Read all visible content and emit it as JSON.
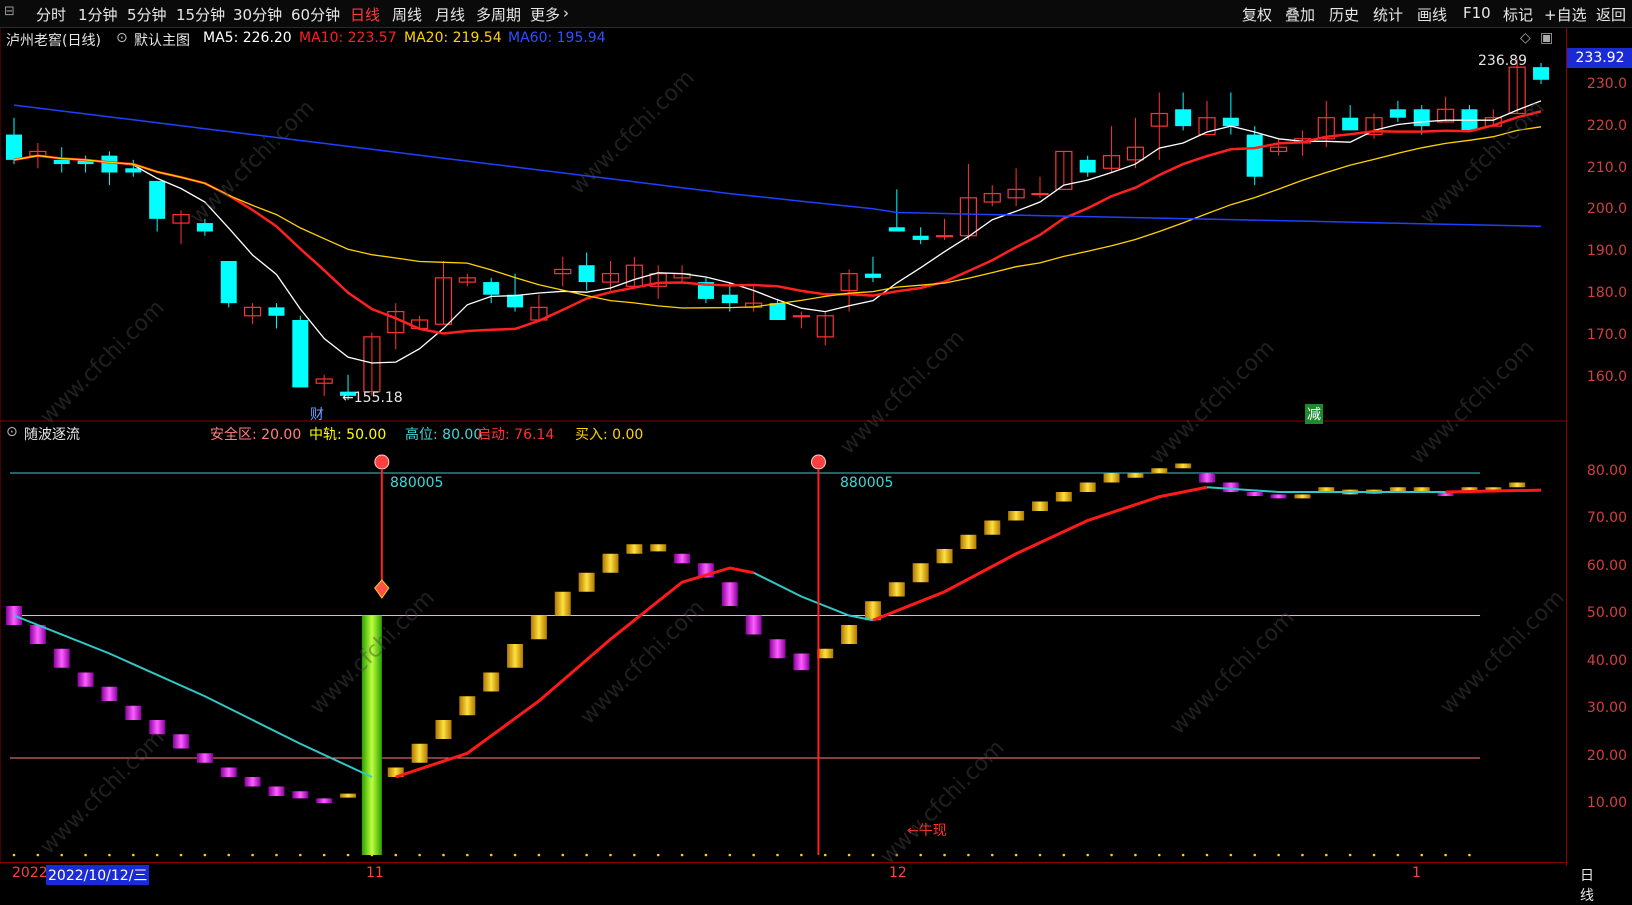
{
  "toolbar": {
    "menu_icon": "menu-icon",
    "left_items": [
      "分时",
      "1分钟",
      "5分钟",
      "15分钟",
      "30分钟",
      "60分钟",
      "日线",
      "周线",
      "月线",
      "多周期",
      "更多"
    ],
    "active_item": "日线",
    "more_arrow": "›",
    "right_items": [
      "复权",
      "叠加",
      "历史",
      "统计",
      "画线",
      "F10",
      "标记",
      "+自选",
      "返回"
    ]
  },
  "info": {
    "stock": "泸州老窖(日线)",
    "main_chart": "默认主图",
    "ma5": "MA5: 226.20",
    "ma10": "MA10: 223.57",
    "ma20": "MA20: 219.54",
    "ma60": "MA60: 195.94"
  },
  "colors": {
    "ma5": "#ffffff",
    "ma10": "#ff2020",
    "ma20": "#ffd200",
    "ma60": "#1e40ff",
    "up": "#ff3333",
    "down": "#00ffff",
    "axis": "#cc3333"
  },
  "main_axis": [
    "230.0",
    "220.0",
    "210.0",
    "200.0",
    "190.0",
    "180.0",
    "170.0",
    "160.0"
  ],
  "price_tag": "233.92",
  "high_label": "236.89",
  "low_label": "←155.18",
  "markers": {
    "cai": "财",
    "jian": "减"
  },
  "sub": {
    "name": "随波逐流",
    "safe": "安全区: 20.00",
    "mid": "中轨: 50.00",
    "high": "高位: 80.00",
    "start": "启动: 76.14",
    "buy": "买入: 0.00",
    "signal1": "880005",
    "signal2": "880005",
    "bull": "←牛现"
  },
  "sub_axis": [
    "80.00",
    "70.00",
    "60.00",
    "50.00",
    "40.00",
    "30.00",
    "20.00",
    "10.00"
  ],
  "dates": {
    "year": "2022",
    "cursor": "2022/10/12/三",
    "m11": "11",
    "m12": "12",
    "m1": "1"
  },
  "period_button": "日线",
  "watermark": "www.cfchi.com",
  "chart_data": {
    "type": "candlestick",
    "candles": [
      [
        218,
        212,
        222,
        211
      ],
      [
        213,
        214,
        216,
        210
      ],
      [
        212,
        211,
        215,
        209
      ],
      [
        212,
        211,
        213,
        209
      ],
      [
        213,
        209,
        214,
        206
      ],
      [
        210,
        209,
        212,
        208
      ],
      [
        207,
        198,
        207,
        195
      ],
      [
        197,
        199,
        200,
        192
      ],
      [
        197,
        195,
        198,
        194
      ],
      [
        188,
        178,
        188,
        177
      ],
      [
        175,
        177,
        178,
        173
      ],
      [
        177,
        175,
        178,
        172
      ],
      [
        174,
        158,
        175,
        158
      ],
      [
        159,
        160,
        161,
        156
      ],
      [
        157,
        156,
        161,
        155
      ],
      [
        157,
        170,
        171,
        156
      ],
      [
        171,
        176,
        178,
        167
      ],
      [
        172,
        174,
        175,
        172
      ],
      [
        173,
        184,
        188,
        173
      ],
      [
        183,
        184,
        185,
        182
      ],
      [
        183,
        180,
        184,
        178
      ],
      [
        180,
        177,
        185,
        176
      ],
      [
        174,
        177,
        180,
        174
      ],
      [
        185,
        186,
        189,
        182
      ],
      [
        187,
        183,
        190,
        181
      ],
      [
        183,
        185,
        188,
        181
      ],
      [
        182,
        187,
        189,
        182
      ],
      [
        182,
        185,
        187,
        179
      ],
      [
        184,
        185,
        187,
        183
      ],
      [
        183,
        179,
        184,
        178
      ],
      [
        180,
        178,
        183,
        176
      ],
      [
        177,
        178,
        182,
        176
      ],
      [
        178,
        174,
        179,
        174
      ],
      [
        175,
        175,
        176,
        172
      ],
      [
        170,
        175,
        176,
        168
      ],
      [
        181,
        185,
        186,
        176
      ],
      [
        185,
        184,
        189,
        183
      ],
      [
        196,
        195,
        205,
        195
      ],
      [
        194,
        193,
        196,
        192
      ],
      [
        194,
        194,
        198,
        193
      ],
      [
        194,
        203,
        211,
        193
      ],
      [
        202,
        204,
        206,
        201
      ],
      [
        203,
        205,
        210,
        201
      ],
      [
        204,
        204,
        208,
        203
      ],
      [
        205,
        214,
        214,
        206
      ],
      [
        212,
        209,
        213,
        208
      ],
      [
        210,
        213,
        220,
        209
      ],
      [
        212,
        215,
        222,
        210
      ],
      [
        220,
        223,
        228,
        212
      ],
      [
        224,
        220,
        228,
        219
      ],
      [
        218,
        222,
        226,
        219
      ],
      [
        222,
        220,
        228,
        218
      ],
      [
        218,
        208,
        220,
        206
      ],
      [
        214,
        215,
        217,
        213
      ],
      [
        216,
        217,
        219,
        213
      ],
      [
        217,
        222,
        226,
        215
      ],
      [
        222,
        219,
        225,
        219
      ],
      [
        218,
        222,
        223,
        217
      ],
      [
        224,
        222,
        226,
        221
      ],
      [
        224,
        220,
        225,
        218
      ],
      [
        221,
        224,
        227,
        221
      ],
      [
        224,
        219,
        225,
        219
      ],
      [
        220,
        222,
        224,
        220
      ],
      [
        223,
        234,
        236,
        223
      ],
      [
        234,
        231,
        235,
        230
      ]
    ],
    "sub_bars": [
      [
        52,
        48,
        "m"
      ],
      [
        48,
        44,
        "m"
      ],
      [
        43,
        39,
        "m"
      ],
      [
        38,
        35,
        "m"
      ],
      [
        35,
        32,
        "m"
      ],
      [
        31,
        28,
        "m"
      ],
      [
        28,
        25,
        "m"
      ],
      [
        25,
        22,
        "m"
      ],
      [
        21,
        19,
        "m"
      ],
      [
        18,
        16,
        "m"
      ],
      [
        16,
        14,
        "m"
      ],
      [
        14,
        12,
        "m"
      ],
      [
        13,
        11.5,
        "m"
      ],
      [
        11.5,
        10.5,
        "m"
      ],
      [
        12,
        12.5,
        "y"
      ],
      [
        50,
        0,
        "g"
      ],
      [
        16,
        18,
        "y"
      ],
      [
        19,
        23,
        "y"
      ],
      [
        24,
        28,
        "y"
      ],
      [
        29,
        33,
        "y"
      ],
      [
        34,
        38,
        "y"
      ],
      [
        39,
        44,
        "y"
      ],
      [
        45,
        50,
        "y"
      ],
      [
        50,
        55,
        "y"
      ],
      [
        55,
        59,
        "y"
      ],
      [
        59,
        63,
        "y"
      ],
      [
        63,
        65,
        "y"
      ],
      [
        65,
        63.5,
        "y"
      ],
      [
        63,
        61,
        "m"
      ],
      [
        61,
        58,
        "m"
      ],
      [
        57,
        52,
        "m"
      ],
      [
        50,
        46,
        "m"
      ],
      [
        45,
        41,
        "m"
      ],
      [
        42,
        38.5,
        "m"
      ],
      [
        41,
        43,
        "y"
      ],
      [
        44,
        48,
        "y"
      ],
      [
        49,
        53,
        "y"
      ],
      [
        54,
        57,
        "y"
      ],
      [
        57,
        61,
        "y"
      ],
      [
        61,
        64,
        "y"
      ],
      [
        64,
        67,
        "y"
      ],
      [
        67,
        70,
        "y"
      ],
      [
        70,
        72,
        "y"
      ],
      [
        72,
        74,
        "y"
      ],
      [
        74,
        76,
        "y"
      ],
      [
        76,
        78,
        "y"
      ],
      [
        78,
        80,
        "y"
      ],
      [
        79,
        80,
        "y"
      ],
      [
        80,
        81,
        "y"
      ],
      [
        81,
        82,
        "y"
      ],
      [
        80,
        78,
        "m"
      ],
      [
        78,
        76,
        "m"
      ],
      [
        76,
        75.5,
        "m"
      ],
      [
        75.5,
        75,
        "m"
      ],
      [
        75,
        75.5,
        "y"
      ],
      [
        76,
        77,
        "y"
      ],
      [
        75.5,
        76.5,
        "y"
      ],
      [
        76,
        76.5,
        "y"
      ],
      [
        76,
        77,
        "y"
      ],
      [
        76.5,
        77,
        "y"
      ],
      [
        76,
        75.5,
        "m"
      ],
      [
        76,
        77,
        "y"
      ],
      [
        76,
        77,
        "y"
      ],
      [
        77,
        78,
        "y"
      ]
    ]
  }
}
